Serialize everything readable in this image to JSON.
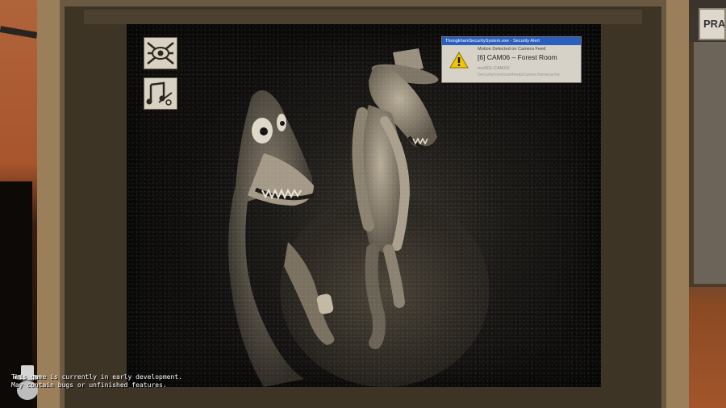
{
  "poster": {
    "text": "PRA"
  },
  "camera_buttons": [
    {
      "icon": "eye-camera-icon"
    },
    {
      "icon": "music-box-icon"
    }
  ],
  "alert": {
    "title": "ThongkhamSecuritySystem.exe - Security Alert",
    "line1": "Motion Detected on Camera Feed",
    "line2": "[6] CAM06 – Forest Room",
    "line3": "nvs501-CAMXX",
    "line4": "/security/core/camfeeds/camxx.framecache",
    "icon": "warning-icon"
  },
  "dev_notice": {
    "line1": "This game is currently in early development.",
    "line2": "May contain bugs or unfinished features."
  },
  "colors": {
    "alert_titlebar": "#2a5fc0",
    "warning": "#f2c500",
    "frame": "#9b7f5a"
  }
}
